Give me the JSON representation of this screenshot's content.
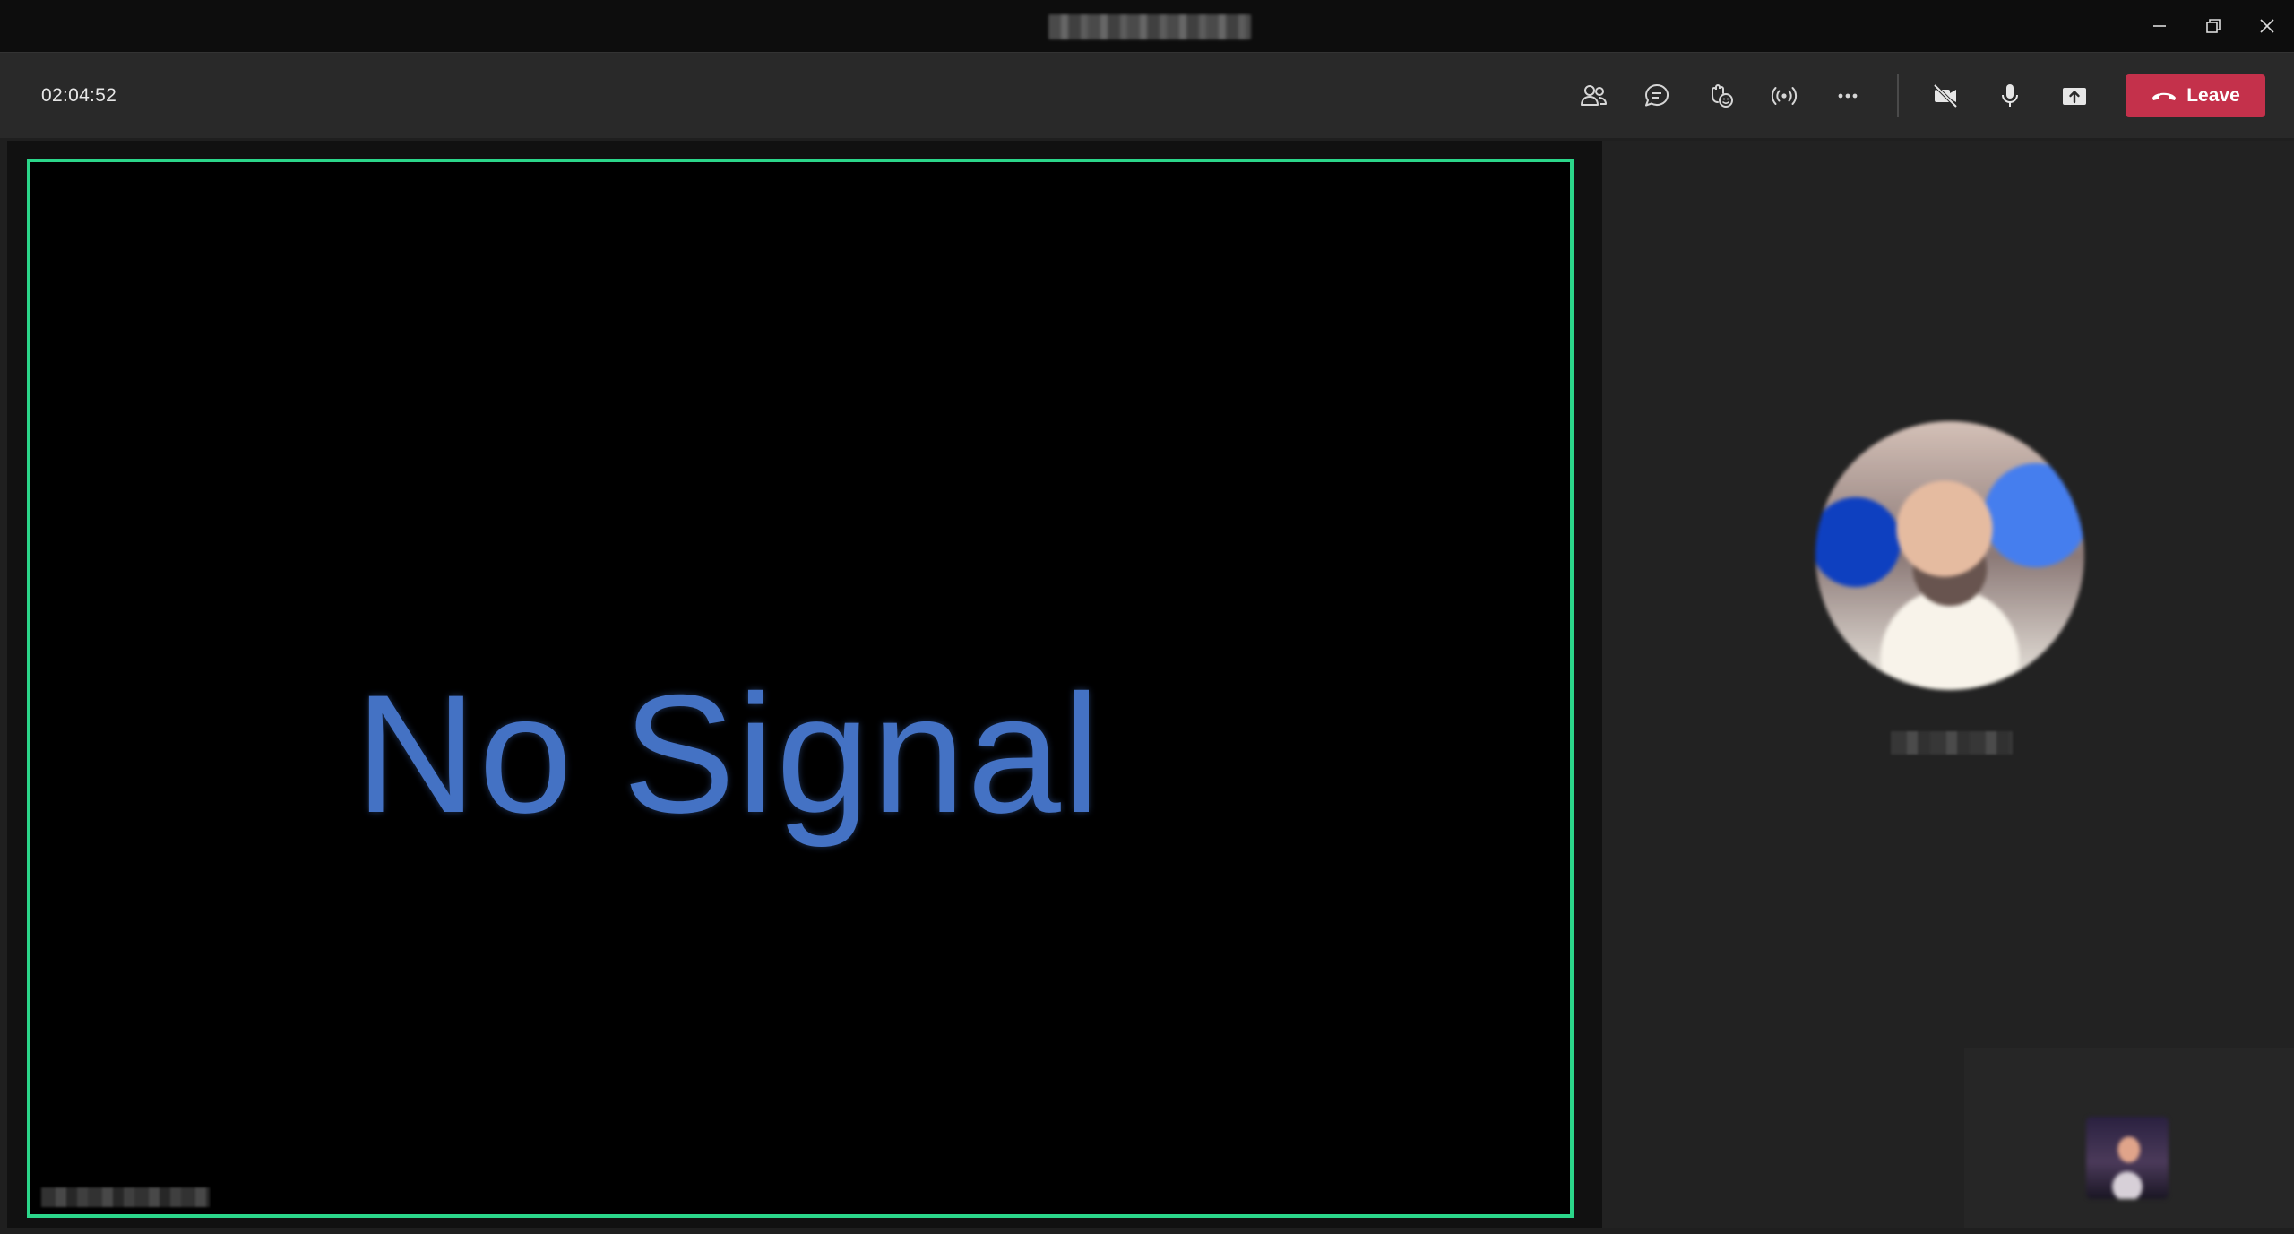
{
  "toolbar": {
    "elapsed_time": "02:04:52",
    "leave_label": "Leave",
    "icons": [
      "participants-icon",
      "chat-icon",
      "reactions-icon",
      "live-broadcast-icon",
      "more-options-icon",
      "camera-off-icon",
      "microphone-icon",
      "share-screen-icon"
    ]
  },
  "stage": {
    "shared_content_text": "No Signal"
  },
  "colors": {
    "leave_button": "#c4314b",
    "active_speaker_border": "#2bd68a",
    "shared_text": "#4472c4",
    "toolbar_bg": "#292929",
    "titlebar_bg": "#0d0d0d"
  }
}
